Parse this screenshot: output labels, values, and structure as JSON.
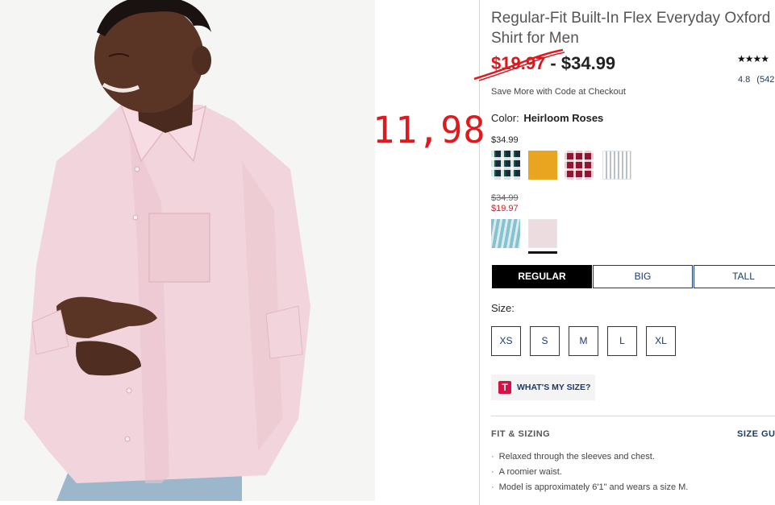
{
  "product": {
    "title_line1": "Regular-Fit Built-In Flex Everyday Oxford",
    "title_line2": "Shirt for Men",
    "price_old": "$19.97",
    "price_sep": "-",
    "price_current": "$34.99",
    "rating_value": "4.8",
    "rating_count": "(542",
    "stars": "★★★★",
    "promo": "Save More with Code at Checkout"
  },
  "annotation": {
    "handwritten_price": "11,98",
    "color": "#e0191f"
  },
  "color_section": {
    "label": "Color:",
    "selected": "Heirloom Roses",
    "group1_price": "$34.99",
    "group2_old_price": "$34.99",
    "group2_sale_price": "$19.97",
    "swatches": [
      {
        "name": "green-plaid"
      },
      {
        "name": "gold"
      },
      {
        "name": "red-plaid"
      },
      {
        "name": "gray-stripe"
      },
      {
        "name": "light-blue-stripe"
      },
      {
        "name": "heirloom-roses",
        "selected": true
      }
    ]
  },
  "fit_tabs": {
    "regular": "REGULAR",
    "big": "BIG",
    "tall": "TALL"
  },
  "size": {
    "label": "Size:",
    "options": [
      "XS",
      "S",
      "M",
      "L",
      "XL"
    ]
  },
  "whats_my_size": {
    "icon": "T",
    "label": "WHAT'S MY SIZE?"
  },
  "fit_sizing": {
    "heading": "FIT & SIZING",
    "size_guide": "SIZE GU",
    "bullets": [
      "Relaxed through the sleeves and chest.",
      "A roomier waist.",
      "Model is approximately 6'1\" and wears a size M."
    ]
  },
  "colors": {
    "sale_red": "#d6191f",
    "navy": "#1a3a6a",
    "selected_swatch": "#ecdcdf"
  }
}
